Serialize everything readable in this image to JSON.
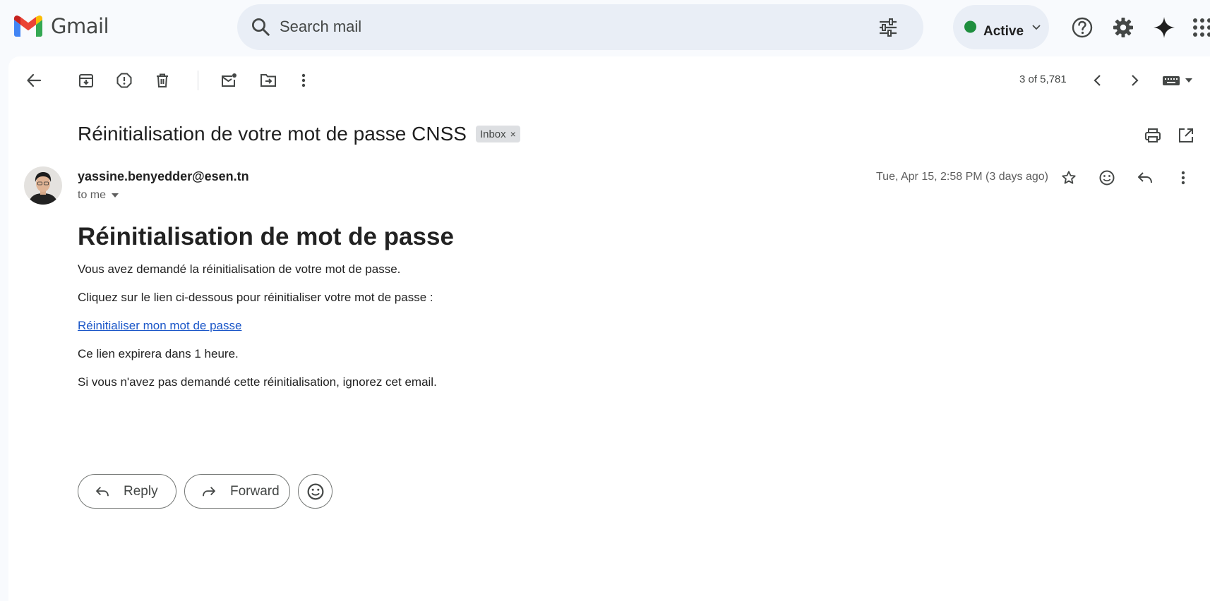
{
  "app": {
    "name": "Gmail"
  },
  "search": {
    "placeholder": "Search mail"
  },
  "status": {
    "label": "Active",
    "color": "#1e8e3e"
  },
  "toolbar": {
    "counter": "3 of 5,781"
  },
  "email": {
    "subject": "Réinitialisation de votre mot de passe CNSS",
    "label": "Inbox",
    "label_remove": "×",
    "sender": "yassine.benyedder@esen.tn",
    "recipient": "to me",
    "date": "Tue, Apr 15, 2:58 PM (3 days ago)",
    "body": {
      "title": "Réinitialisation de mot de passe",
      "line1": "Vous avez demandé la réinitialisation de votre mot de passe.",
      "line2": "Cliquez sur le lien ci-dessous pour réinitialiser votre mot de passe :",
      "link": "Réinitialiser mon mot de passe",
      "line3": "Ce lien expirera dans 1 heure.",
      "line4": "Si vous n'avez pas demandé cette réinitialisation, ignorez cet email."
    }
  },
  "actions": {
    "reply": "Reply",
    "forward": "Forward"
  },
  "colors": {
    "link": "#1a56c8",
    "panel": "#ffffff",
    "background": "#f8fafd",
    "search_bg": "#e9eef6"
  }
}
